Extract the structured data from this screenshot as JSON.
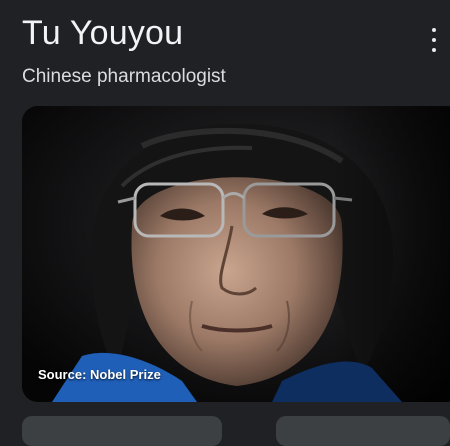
{
  "header": {
    "title": "Tu Youyou",
    "subtitle": "Chinese pharmacologist",
    "menu_icon": "more-vert-icon"
  },
  "image": {
    "caption": "Source: Nobel Prize"
  },
  "colors": {
    "background": "#202124",
    "text_primary": "#f1f3f4",
    "text_secondary": "#dadce0",
    "shirt_blue": "#1f5fb8"
  }
}
